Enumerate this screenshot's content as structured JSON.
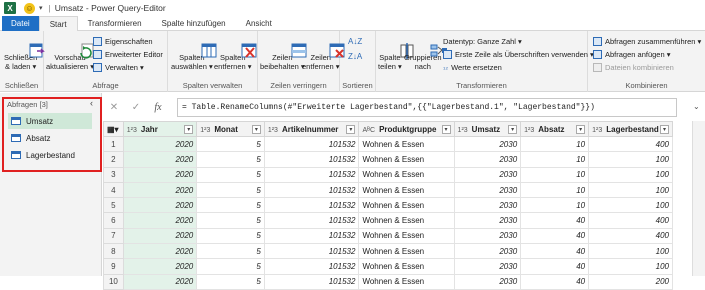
{
  "titlebar": {
    "app_icon": "X",
    "title": "Umsatz - Power Query-Editor"
  },
  "tabs": [
    "Datei",
    "Start",
    "Transformieren",
    "Spalte hinzufügen",
    "Ansicht"
  ],
  "ribbon": {
    "schliessen": {
      "btn": "Schließen\n& laden ▾",
      "label": "Schließen"
    },
    "abfrage": {
      "vorschau": "Vorschau\naktualisieren ▾",
      "eigenschaften": "Eigenschaften",
      "erweiterter_editor": "Erweiterter Editor",
      "verwalten": "Verwalten ▾",
      "label": "Abfrage"
    },
    "spalten": {
      "auswaehlen": "Spalten\nauswählen ▾",
      "entfernen": "Spalten\nentfernen ▾",
      "label": "Spalten verwalten"
    },
    "zeilen": {
      "beibehalten": "Zeilen\nbeibehalten ▾",
      "entfernen": "Zeilen\nentfernen ▾",
      "label": "Zeilen verringern"
    },
    "sortieren": {
      "label": "Sortieren"
    },
    "transform": {
      "spalte_teilen": "Spalte\nteilen ▾",
      "gruppieren": "Gruppieren\nnach",
      "datentyp": "Datentyp: Ganze Zahl ▾",
      "erste_zeile": "Erste Zeile als Überschriften verwenden ▾",
      "werte_ersetzen": "Werte ersetzen",
      "label": "Transformieren"
    },
    "kombinieren": {
      "zusammenfuehren": "Abfragen zusammenführen ▾",
      "anfuegen": "Abfragen anfügen ▾",
      "dateien": "Dateien kombinieren",
      "label": "Kombinieren"
    }
  },
  "queries": {
    "header": "Abfragen [3]",
    "items": [
      "Umsatz",
      "Absatz",
      "Lagerbestand"
    ]
  },
  "formula": "= Table.RenameColumns(#\"Erweiterte Lagerbestand\",{{\"Lagerbestand.1\", \"Lagerbestand\"}})",
  "columns": [
    {
      "type": "1²3",
      "name": "Jahr"
    },
    {
      "type": "1²3",
      "name": "Monat"
    },
    {
      "type": "1²3",
      "name": "Artikelnummer"
    },
    {
      "type": "AᴮC",
      "name": "Produktgruppe"
    },
    {
      "type": "1²3",
      "name": "Umsatz"
    },
    {
      "type": "1²3",
      "name": "Absatz"
    },
    {
      "type": "1²3",
      "name": "Lagerbestand"
    }
  ],
  "rows": [
    [
      "1",
      "2020",
      "5",
      "101532",
      "Wohnen & Essen",
      "2030",
      "10",
      "400"
    ],
    [
      "2",
      "2020",
      "5",
      "101532",
      "Wohnen & Essen",
      "2030",
      "10",
      "100"
    ],
    [
      "3",
      "2020",
      "5",
      "101532",
      "Wohnen & Essen",
      "2030",
      "10",
      "100"
    ],
    [
      "4",
      "2020",
      "5",
      "101532",
      "Wohnen & Essen",
      "2030",
      "10",
      "100"
    ],
    [
      "5",
      "2020",
      "5",
      "101532",
      "Wohnen & Essen",
      "2030",
      "10",
      "100"
    ],
    [
      "6",
      "2020",
      "5",
      "101532",
      "Wohnen & Essen",
      "2030",
      "40",
      "400"
    ],
    [
      "7",
      "2020",
      "5",
      "101532",
      "Wohnen & Essen",
      "2030",
      "40",
      "400"
    ],
    [
      "8",
      "2020",
      "5",
      "101532",
      "Wohnen & Essen",
      "2030",
      "40",
      "100"
    ],
    [
      "9",
      "2020",
      "5",
      "101532",
      "Wohnen & Essen",
      "2030",
      "40",
      "100"
    ],
    [
      "10",
      "2020",
      "5",
      "101532",
      "Wohnen & Essen",
      "2030",
      "40",
      "200"
    ]
  ]
}
